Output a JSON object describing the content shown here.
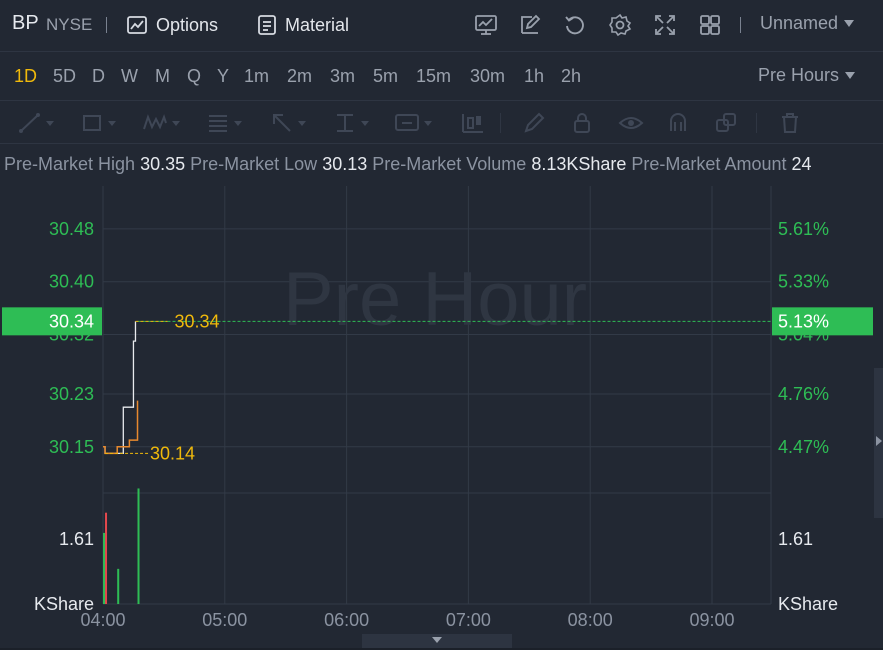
{
  "header": {
    "ticker": "BP",
    "exchange": "NYSE",
    "options_label": "Options",
    "material_label": "Material",
    "layout_name": "Unnamed"
  },
  "periods": {
    "items": [
      "1D",
      "5D",
      "D",
      "W",
      "M",
      "Q",
      "Y",
      "1m",
      "2m",
      "3m",
      "5m",
      "15m",
      "30m",
      "1h",
      "2h"
    ],
    "active": "1D",
    "session_label": "Pre Hours"
  },
  "drawing_tools": [
    "trend-line-tool",
    "rectangle-tool",
    "wave-tool",
    "fibonacci-tool",
    "arrow-tool",
    "price-range-tool",
    "text-label-tool",
    "candle-tool",
    "pencil-tool",
    "lock-tool",
    "visibility-tool",
    "magnet-tool",
    "clone-tool",
    "delete-tool"
  ],
  "info": {
    "high_label": "Pre-Market High",
    "high_value": "30.35",
    "low_label": "Pre-Market Low",
    "low_value": "30.13",
    "volume_label": "Pre-Market Volume",
    "volume_value": "8.13KShare",
    "amount_label": "Pre-Market Amount",
    "amount_value": "24"
  },
  "colors": {
    "up": "#2ebd55",
    "down": "#e5484d",
    "accent": "#f0b90b",
    "price_line": "#e8eaee",
    "avg_line": "#e8892e",
    "background": "#222833",
    "grid": "#323a47"
  },
  "chart_data": {
    "type": "line",
    "watermark": "Pre Hour",
    "x_ticks": [
      "04:00",
      "05:00",
      "06:00",
      "07:00",
      "08:00",
      "09:00"
    ],
    "x_range": [
      "04:00",
      "09:30"
    ],
    "y_left_ticks": [
      "30.48",
      "30.40",
      "30.32",
      "30.23",
      "30.15"
    ],
    "y_right_ticks": [
      "5.61%",
      "5.33%",
      "5.04%",
      "4.76%",
      "4.47%"
    ],
    "y_range": [
      30.08,
      30.545
    ],
    "current_price": "30.34",
    "current_change": "5.13%",
    "high_marker": "30.34",
    "low_marker": "30.14",
    "volume_tick_left": "1.61",
    "volume_tick_right": "1.61",
    "volume_unit_left": "KShare",
    "volume_unit_right": "KShare",
    "volume_max": 2.5,
    "series": [
      {
        "x": [
          "04:00",
          "04:01",
          "04:02",
          "04:03",
          "04:06",
          "04:10",
          "04:13",
          "04:14",
          "04:15",
          "04:16",
          "04:17",
          "04:30"
        ],
        "values": [
          30.15,
          30.14,
          30.14,
          30.14,
          30.14,
          30.21,
          30.21,
          30.21,
          30.31,
          30.34,
          30.34,
          30.34
        ]
      },
      {
        "x": [
          "04:00",
          "04:01",
          "04:06",
          "04:07",
          "04:10",
          "04:13",
          "04:16",
          "04:17"
        ],
        "values": [
          30.15,
          30.14,
          30.14,
          30.15,
          30.15,
          30.16,
          30.16,
          30.22
        ]
      }
    ],
    "volume": [
      {
        "x": "04:01",
        "value": 2.26,
        "dir": "down"
      },
      {
        "x": "04:01",
        "value": 1.76,
        "dir": "up"
      },
      {
        "x": "04:07",
        "value": 0.87,
        "dir": "up"
      },
      {
        "x": "04:17",
        "value": 2.86,
        "dir": "up"
      }
    ]
  }
}
